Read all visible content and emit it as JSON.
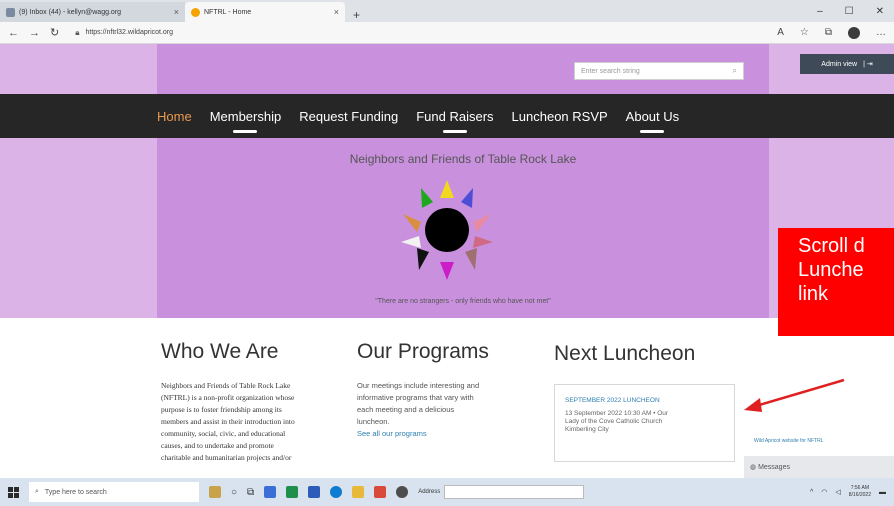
{
  "browser": {
    "tabs": [
      {
        "label": "(9) Inbox (44) - kellyn@wagg.org",
        "active": false
      },
      {
        "label": "NFTRL - Home",
        "active": true
      }
    ],
    "url": "https://nftrl32.wildapricot.org"
  },
  "site": {
    "search_placeholder": "Enter search string",
    "admin_label": "Admin view",
    "nav": [
      "Home",
      "Membership",
      "Request Funding",
      "Fund Raisers",
      "Luncheon RSVP",
      "About Us"
    ],
    "title": "Neighbors and Friends of Table Rock Lake",
    "tagline": "\"There are no strangers - only friends who have not met\""
  },
  "sections": {
    "who": {
      "title": "Who We Are",
      "lines": [
        "Neighbors and Friends of Table Rock Lake",
        "(NFTRL) is a non-profit organization whose",
        "purpose is to foster friendship among its",
        "members and assist in their introduction into",
        "community, social, civic, and educational",
        "causes, and to undertake and promote",
        "charitable and humanitarian projects and/or"
      ]
    },
    "programs": {
      "title": "Our Programs",
      "lines": [
        "Our meetings include interesting and",
        "informative programs that vary with",
        "each meeting and a delicious",
        "luncheon."
      ],
      "link": "See all our programs"
    },
    "luncheon": {
      "title": "Next Luncheon",
      "card_title": "SEPTEMBER 2022 LUNCHEON",
      "card_lines": [
        "13 September 2022 10:30 AM • Our",
        "Lady of the Cove Catholic Church",
        "Kimberling City"
      ]
    }
  },
  "sidebar": {
    "link": "Wild Apricot website for NFTRL",
    "messages": "Messages"
  },
  "annotation": {
    "lines": [
      "Scroll d",
      "Lunche",
      "link"
    ]
  },
  "taskbar": {
    "search_placeholder": "Type here to search",
    "address_label": "Address",
    "time": "7:56 AM",
    "date": "8/16/2022"
  }
}
